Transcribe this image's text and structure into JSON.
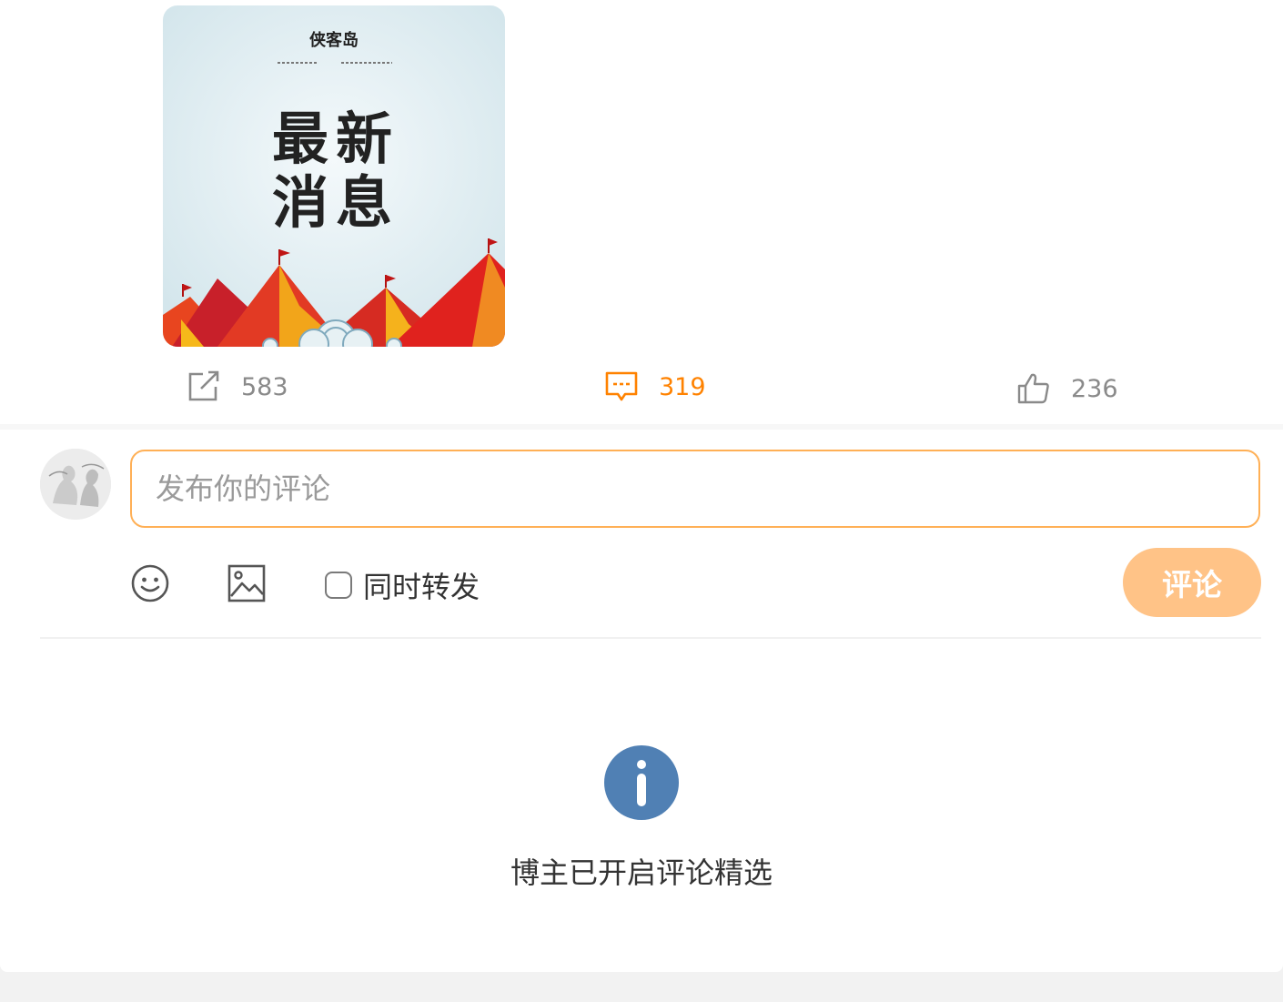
{
  "post": {
    "image": {
      "alt": "最新消息",
      "brand_text": "侠客岛",
      "headline_line1": "最新",
      "headline_line2": "消息"
    }
  },
  "actions": {
    "repost_count": "583",
    "comment_count": "319",
    "like_count": "236"
  },
  "composer": {
    "placeholder": "发布你的评论",
    "repost_label": "同时转发",
    "submit_label": "评论"
  },
  "notice": {
    "text": "博主已开启评论精选"
  },
  "colors": {
    "accent": "#ff8200",
    "input_border": "#ffb056",
    "submit_bg": "#ffc387",
    "info_icon": "#5080b4"
  }
}
